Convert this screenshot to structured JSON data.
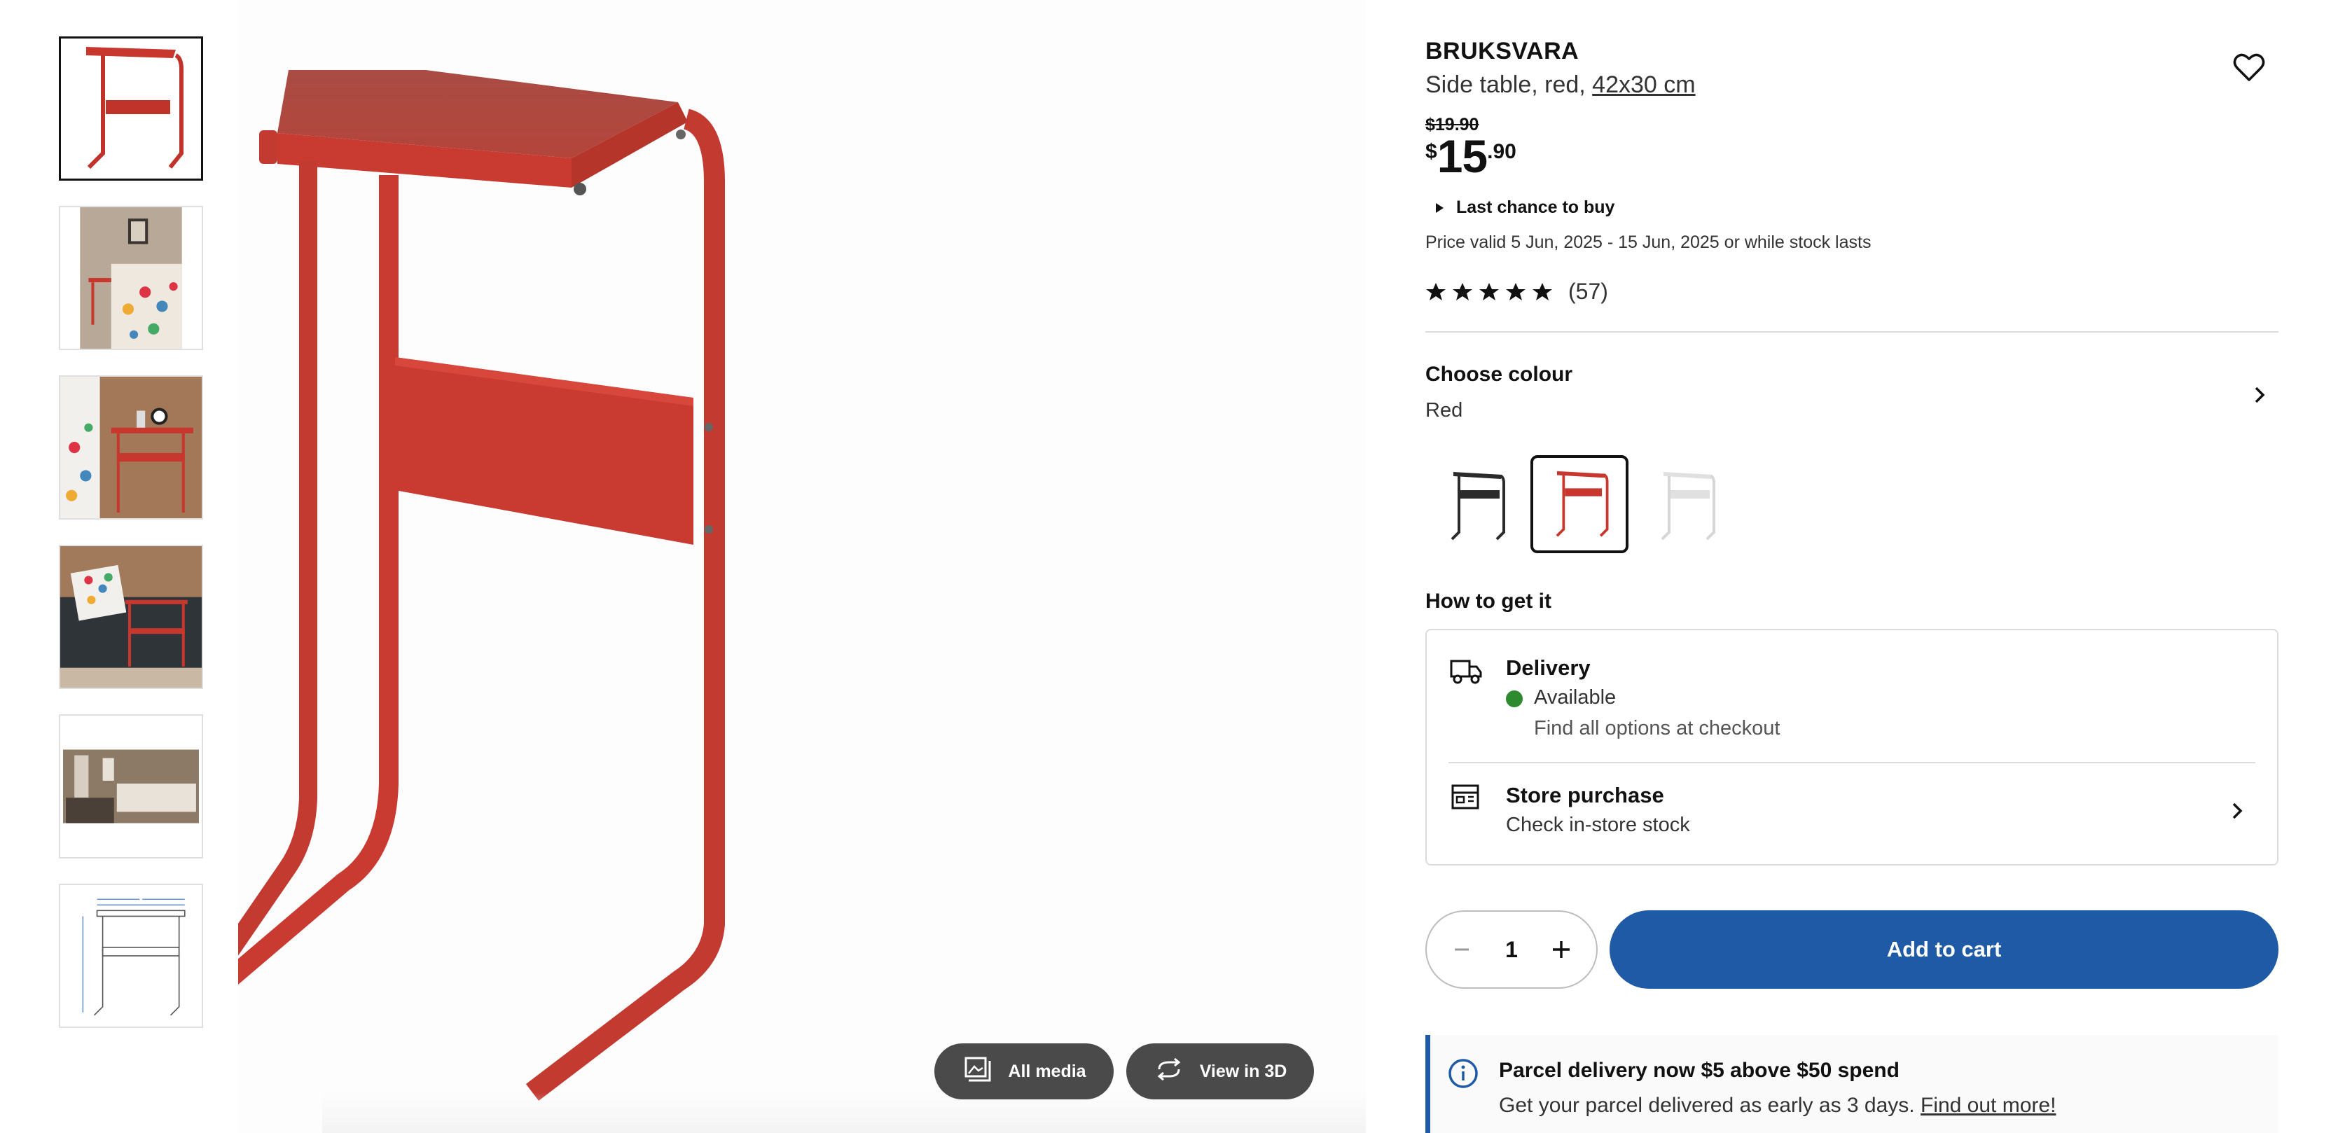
{
  "product": {
    "name": "BRUKSVARA",
    "description_prefix": "Side table, red,",
    "dimensions_link": "42x30 cm",
    "old_price": "$19.90",
    "price_currency": "$",
    "price_whole": "15",
    "price_decimal": ".90",
    "last_chance": "Last chance to buy",
    "validity": "Price valid 5 Jun, 2025 - 15 Jun, 2025 or while stock lasts",
    "rating": 5,
    "reviews": "(57)"
  },
  "colour": {
    "heading": "Choose colour",
    "selected": "Red",
    "options": [
      {
        "name": "black",
        "color": "#2b2b2b"
      },
      {
        "name": "red",
        "color": "#c8372d"
      },
      {
        "name": "white",
        "color": "#e6e6e6"
      }
    ]
  },
  "fulfilment": {
    "heading": "How to get it",
    "delivery_title": "Delivery",
    "delivery_status": "Available",
    "delivery_note": "Find all options at checkout",
    "store_title": "Store purchase",
    "store_note": "Check in-store stock"
  },
  "cart": {
    "quantity": "1",
    "add_label": "Add to cart"
  },
  "notice": {
    "title": "Parcel delivery now $5 above $50 spend",
    "body": "Get your parcel delivered as early as 3 days.",
    "link": "Find out more!"
  },
  "media": {
    "all_media": "All media",
    "view_3d": "View in 3D",
    "thumbnails": [
      "product-red",
      "bedroom-scene",
      "bedside-scene",
      "sofa-scene",
      "room-scene",
      "dimension-drawing"
    ]
  },
  "colors": {
    "accent_blue": "#1f5aa6",
    "product_red": "#c8372d",
    "available_green": "#2e8a2e"
  }
}
